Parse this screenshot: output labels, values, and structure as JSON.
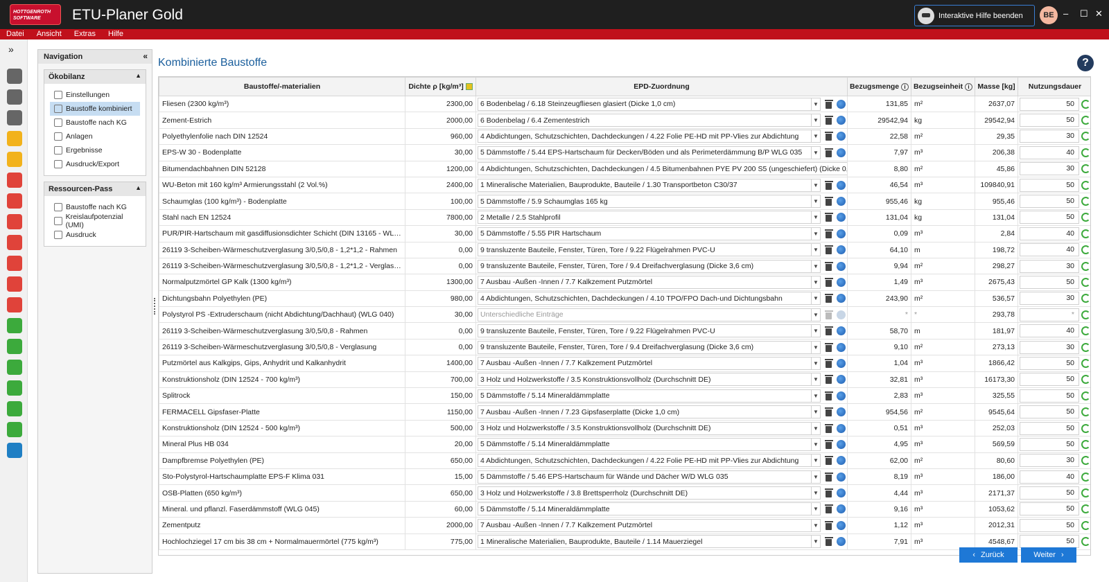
{
  "app": {
    "logo_line1": "HOTTGENROTH",
    "logo_line2": "SOFTWARE",
    "title": "ETU-Planer Gold",
    "help_button": "Interaktive Hilfe beenden",
    "avatar_initials": "BE",
    "minimize": "–",
    "maximize": "☐",
    "close": "✕"
  },
  "menu": [
    "Datei",
    "Ansicht",
    "Extras",
    "Hilfe"
  ],
  "iconbar": {
    "expand": "»",
    "items": [
      {
        "icon": "tree-icon",
        "color": "#666666"
      },
      {
        "icon": "folder-icon",
        "color": "#666666"
      },
      {
        "icon": "location-pin-icon",
        "color": "#666666"
      },
      {
        "icon": "house-icon",
        "color": "#f2b21b"
      },
      {
        "icon": "lightning-icon",
        "color": "#f2b21b"
      },
      {
        "icon": "house-red-icon",
        "color": "#e0433a"
      },
      {
        "icon": "heating-icon",
        "color": "#e0433a"
      },
      {
        "icon": "chart-red-icon",
        "color": "#e0433a"
      },
      {
        "icon": "pipes-icon",
        "color": "#e0433a"
      },
      {
        "icon": "tap-icon",
        "color": "#e0433a"
      },
      {
        "icon": "drain-icon",
        "color": "#e0433a"
      },
      {
        "icon": "house-fire-icon",
        "color": "#e0433a"
      },
      {
        "icon": "house-green-icon",
        "color": "#3caa3c"
      },
      {
        "icon": "house-green-active-icon",
        "color": "#3caa3c"
      },
      {
        "icon": "calc-green-icon",
        "color": "#3caa3c"
      },
      {
        "icon": "globe-green-icon",
        "color": "#3caa3c"
      },
      {
        "icon": "building-green-icon",
        "color": "#3caa3c"
      },
      {
        "icon": "document-green-icon",
        "color": "#3caa3c"
      },
      {
        "icon": "euro-icon",
        "color": "#1f7fc4"
      }
    ]
  },
  "navigation": {
    "title": "Navigation",
    "collapse": "«",
    "sections": [
      {
        "title": "Ökobilanz",
        "items": [
          {
            "label": "Einstellungen",
            "active": false
          },
          {
            "label": "Baustoffe kombiniert",
            "active": true
          },
          {
            "label": "Baustoffe nach KG",
            "active": false
          },
          {
            "label": "Anlagen",
            "active": false
          },
          {
            "label": "Ergebnisse",
            "active": false
          },
          {
            "label": "Ausdruck/Export",
            "active": false
          }
        ]
      },
      {
        "title": "Ressourcen-Pass",
        "items": [
          {
            "label": "Baustoffe nach KG",
            "active": false
          },
          {
            "label": "Kreislaufpotenzial (UMI)",
            "active": false
          },
          {
            "label": "Ausdruck",
            "active": false
          }
        ]
      }
    ]
  },
  "page": {
    "title": "Kombinierte Baustoffe",
    "help": "?"
  },
  "table": {
    "headers": [
      "Baustoffe/-materialien",
      "Dichte ρ [kg/m³]",
      "EPD-Zuordnung",
      "Bezugsmenge",
      "Bezugseinheit",
      "Masse [kg]",
      "Nutzungsdauer"
    ],
    "rows": [
      {
        "name": "Fliesen (2300 kg/m³)",
        "dichte": "2300,00",
        "epd": "6 Bodenbelag / 6.18 Steinzeugfliesen glasiert (Dicke 1,0 cm)",
        "menge": "131,85",
        "einheit": "m²",
        "masse": "2637,07",
        "dauer": "50"
      },
      {
        "name": "Zement-Estrich",
        "dichte": "2000,00",
        "epd": "6 Bodenbelag / 6.4 Zementestrich",
        "menge": "29542,94",
        "einheit": "kg",
        "masse": "29542,94",
        "dauer": "50"
      },
      {
        "name": "Polyethylenfolie nach DIN 12524",
        "dichte": "960,00",
        "epd": "4 Abdichtungen, Schutzschichten, Dachdeckungen / 4.22 Folie PE-HD mit PP-Vlies zur Abdichtung",
        "menge": "22,58",
        "einheit": "m²",
        "masse": "29,35",
        "dauer": "30"
      },
      {
        "name": "EPS-W 30 - Bodenplatte",
        "dichte": "30,00",
        "epd": "5 Dämmstoffe / 5.44 EPS-Hartschaum für Decken/Böden und als Perimeterdämmung B/P WLG 035",
        "menge": "7,97",
        "einheit": "m³",
        "masse": "206,38",
        "dauer": "40"
      },
      {
        "name": "Bitumendachbahnen DIN 52128",
        "dichte": "1200,00",
        "epd": "4 Abdichtungen, Schutzschichten, Dachdeckungen / 4.5 Bitumenbahnen PYE PV 200 S5 (ungeschiefert) (Dicke 0,5 cm)",
        "menge": "8,80",
        "einheit": "m²",
        "masse": "45,86",
        "dauer": "30"
      },
      {
        "name": "WU-Beton mit 160 kg/m³ Armierungsstahl (2 Vol.%)",
        "dichte": "2400,00",
        "epd": "1 Mineralische Materialien, Bauprodukte, Bauteile / 1.30 Transportbeton C30/37",
        "menge": "46,54",
        "einheit": "m³",
        "masse": "109840,91",
        "dauer": "50"
      },
      {
        "name": "Schaumglas (100 kg/m³) - Bodenplatte",
        "dichte": "100,00",
        "epd": "5 Dämmstoffe / 5.9 Schaumglas 165 kg",
        "menge": "955,46",
        "einheit": "kg",
        "masse": "955,46",
        "dauer": "50"
      },
      {
        "name": "Stahl nach EN 12524",
        "dichte": "7800,00",
        "epd": "2 Metalle / 2.5 Stahlprofil",
        "menge": "131,04",
        "einheit": "kg",
        "masse": "131,04",
        "dauer": "50"
      },
      {
        "name": "PUR/PIR-Hartschaum mit gasdiffusionsdichter Schicht (DIN 13165 - WLG 024)",
        "dichte": "30,00",
        "epd": "5 Dämmstoffe / 5.55 PIR Hartschaum",
        "menge": "0,09",
        "einheit": "m³",
        "masse": "2,84",
        "dauer": "40"
      },
      {
        "name": "26119 3-Scheiben-Wärmeschutzverglasung 3/0,5/0,8 - 1,2*1,2 - Rahmen",
        "dichte": "0,00",
        "epd": "9 transluzente Bauteile, Fenster, Türen, Tore / 9.22 Flügelrahmen PVC-U",
        "menge": "64,10",
        "einheit": "m",
        "masse": "198,72",
        "dauer": "40"
      },
      {
        "name": "26119 3-Scheiben-Wärmeschutzverglasung 3/0,5/0,8 - 1,2*1,2 - Verglasung",
        "dichte": "0,00",
        "epd": "9 transluzente Bauteile, Fenster, Türen, Tore / 9.4 Dreifachverglasung (Dicke 3,6 cm)",
        "menge": "9,94",
        "einheit": "m²",
        "masse": "298,27",
        "dauer": "30"
      },
      {
        "name": "Normalputzmörtel GP Kalk (1300 kg/m³)",
        "dichte": "1300,00",
        "epd": "7 Ausbau -Außen -Innen / 7.7 Kalkzement Putzmörtel",
        "menge": "1,49",
        "einheit": "m³",
        "masse": "2675,43",
        "dauer": "50"
      },
      {
        "name": "Dichtungsbahn Polyethylen (PE)",
        "dichte": "980,00",
        "epd": "4 Abdichtungen, Schutzschichten, Dachdeckungen / 4.10 TPO/FPO Dach-und Dichtungsbahn",
        "menge": "243,90",
        "einheit": "m²",
        "masse": "536,57",
        "dauer": "30"
      },
      {
        "name": "Polystyrol PS -Extruderschaum (nicht Abdichtung/Dachhaut) (WLG 040)",
        "dichte": "30,00",
        "epd": "Unterschiedliche Einträge",
        "menge": "*",
        "einheit": "*",
        "masse": "293,78",
        "dauer": "*",
        "muted": true
      },
      {
        "name": "26119 3-Scheiben-Wärmeschutzverglasung 3/0,5/0,8 - Rahmen",
        "dichte": "0,00",
        "epd": "9 transluzente Bauteile, Fenster, Türen, Tore / 9.22 Flügelrahmen PVC-U",
        "menge": "58,70",
        "einheit": "m",
        "masse": "181,97",
        "dauer": "40"
      },
      {
        "name": "26119 3-Scheiben-Wärmeschutzverglasung 3/0,5/0,8 - Verglasung",
        "dichte": "0,00",
        "epd": "9 transluzente Bauteile, Fenster, Türen, Tore / 9.4 Dreifachverglasung (Dicke 3,6 cm)",
        "menge": "9,10",
        "einheit": "m²",
        "masse": "273,13",
        "dauer": "30"
      },
      {
        "name": "Putzmörtel aus Kalkgips, Gips, Anhydrit und Kalkanhydrit",
        "dichte": "1400,00",
        "epd": "7 Ausbau -Außen -Innen / 7.7 Kalkzement Putzmörtel",
        "menge": "1,04",
        "einheit": "m³",
        "masse": "1866,42",
        "dauer": "50"
      },
      {
        "name": "Konstruktionsholz  (DIN 12524 - 700 kg/m³)",
        "dichte": "700,00",
        "epd": "3 Holz und Holzwerkstoffe / 3.5 Konstruktionsvollholz (Durchschnitt DE)",
        "menge": "32,81",
        "einheit": "m³",
        "masse": "16173,30",
        "dauer": "50"
      },
      {
        "name": "Splitrock",
        "dichte": "150,00",
        "epd": "5 Dämmstoffe / 5.14 Mineraldämmplatte",
        "menge": "2,83",
        "einheit": "m³",
        "masse": "325,55",
        "dauer": "50"
      },
      {
        "name": "FERMACELL Gipsfaser-Platte",
        "dichte": "1150,00",
        "epd": "7 Ausbau -Außen -Innen / 7.23 Gipsfaserplatte (Dicke 1,0 cm)",
        "menge": "954,56",
        "einheit": "m²",
        "masse": "9545,64",
        "dauer": "50"
      },
      {
        "name": "Konstruktionsholz  (DIN 12524 - 500 kg/m³)",
        "dichte": "500,00",
        "epd": "3 Holz und Holzwerkstoffe / 3.5 Konstruktionsvollholz (Durchschnitt DE)",
        "menge": "0,51",
        "einheit": "m³",
        "masse": "252,03",
        "dauer": "50"
      },
      {
        "name": "Mineral Plus HB 034",
        "dichte": "20,00",
        "epd": "5 Dämmstoffe / 5.14 Mineraldämmplatte",
        "menge": "4,95",
        "einheit": "m³",
        "masse": "569,59",
        "dauer": "50"
      },
      {
        "name": "Dampfbremse Polyethylen (PE)",
        "dichte": "650,00",
        "epd": "4 Abdichtungen, Schutzschichten, Dachdeckungen / 4.22 Folie PE-HD mit PP-Vlies zur Abdichtung",
        "menge": "62,00",
        "einheit": "m²",
        "masse": "80,60",
        "dauer": "30"
      },
      {
        "name": "Sto-Polystyrol-Hartschaumplatte EPS-F Klima 031",
        "dichte": "15,00",
        "epd": "5 Dämmstoffe / 5.46 EPS-Hartschaum für Wände und Dächer W/D WLG 035",
        "menge": "8,19",
        "einheit": "m³",
        "masse": "186,00",
        "dauer": "40"
      },
      {
        "name": "OSB-Platten (650 kg/m³)",
        "dichte": "650,00",
        "epd": "3 Holz und Holzwerkstoffe / 3.8 Brettsperrholz (Durchschnitt DE)",
        "menge": "4,44",
        "einheit": "m³",
        "masse": "2171,37",
        "dauer": "50"
      },
      {
        "name": "Mineral. und pflanzl. Faserdämmstoff  (WLG 045)",
        "dichte": "60,00",
        "epd": "5 Dämmstoffe / 5.14 Mineraldämmplatte",
        "menge": "9,16",
        "einheit": "m³",
        "masse": "1053,62",
        "dauer": "50"
      },
      {
        "name": "Zementputz",
        "dichte": "2000,00",
        "epd": "7 Ausbau -Außen -Innen / 7.7 Kalkzement Putzmörtel",
        "menge": "1,12",
        "einheit": "m³",
        "masse": "2012,31",
        "dauer": "50"
      },
      {
        "name": "Hochlochziegel 17 cm bis 38 cm + Normalmauermörtel (775 kg/m³)",
        "dichte": "775,00",
        "epd": "1 Mineralische Materialien, Bauprodukte, Bauteile / 1.14 Mauerziegel",
        "menge": "7,91",
        "einheit": "m³",
        "masse": "4548,67",
        "dauer": "50"
      }
    ]
  },
  "footer": {
    "back": "Zurück",
    "next": "Weiter"
  }
}
